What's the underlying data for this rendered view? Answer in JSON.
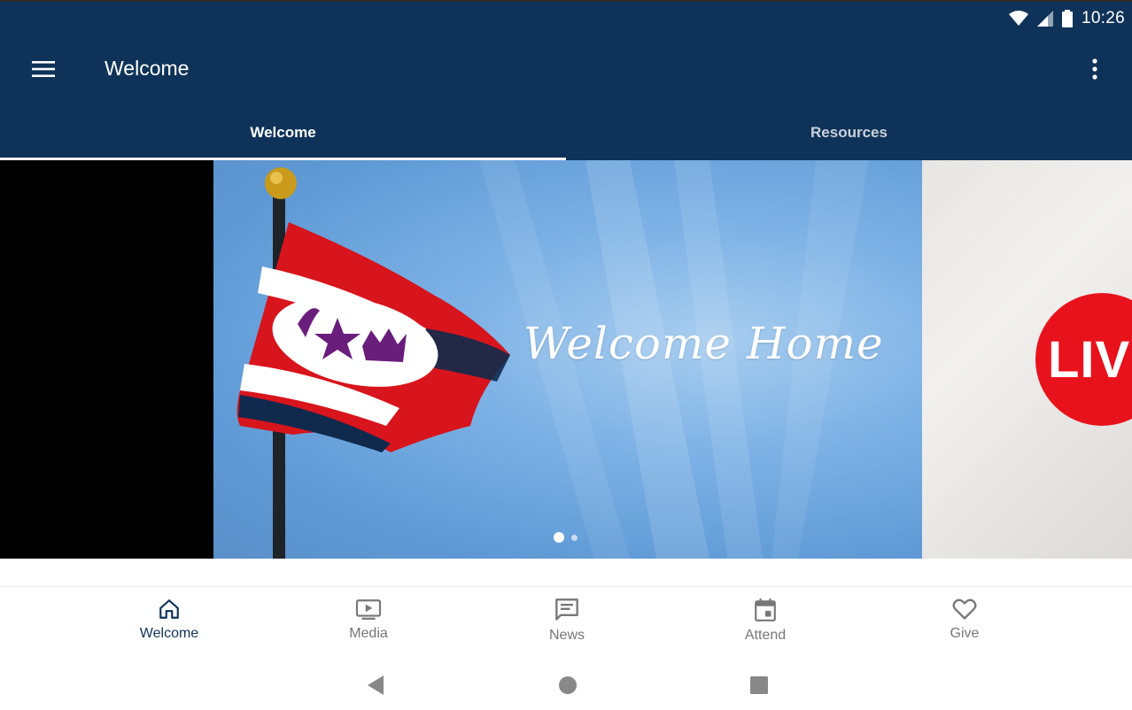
{
  "status_bar": {
    "time": "10:26"
  },
  "app_bar": {
    "title": "Welcome"
  },
  "tabs": [
    {
      "label": "Welcome",
      "active": true
    },
    {
      "label": "Resources",
      "active": false
    }
  ],
  "carousel": {
    "current_slide_text": "Welcome Home",
    "next_slide_text": "LIV",
    "page_count": 2,
    "current_page": 1
  },
  "bottom_nav": [
    {
      "label": "Welcome",
      "icon": "home-icon",
      "active": true
    },
    {
      "label": "Media",
      "icon": "tv-play-icon",
      "active": false
    },
    {
      "label": "News",
      "icon": "message-icon",
      "active": false
    },
    {
      "label": "Attend",
      "icon": "calendar-icon",
      "active": false
    },
    {
      "label": "Give",
      "icon": "heart-icon",
      "active": false
    }
  ],
  "colors": {
    "primary": "#0f3358",
    "inactive": "#777777",
    "live_red": "#e8121c"
  }
}
